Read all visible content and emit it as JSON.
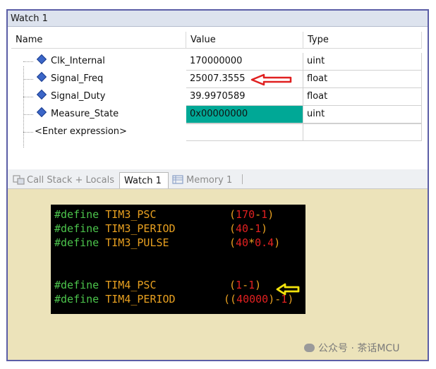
{
  "window": {
    "title": "Watch 1"
  },
  "columns": {
    "name": "Name",
    "value": "Value",
    "type": "Type"
  },
  "rows": [
    {
      "name": "Clk_Internal",
      "value": "170000000",
      "type": "uint"
    },
    {
      "name": "Signal_Freq",
      "value": "25007.3555",
      "type": "float"
    },
    {
      "name": "Signal_Duty",
      "value": "39.9970589",
      "type": "float"
    },
    {
      "name": "Measure_State",
      "value": "0x00000000",
      "type": "uint"
    }
  ],
  "enter_expression": "<Enter expression>",
  "tabs": [
    {
      "label": "Call Stack + Locals"
    },
    {
      "label": "Watch 1"
    },
    {
      "label": "Memory 1"
    }
  ],
  "code": [
    {
      "kw": "#define",
      "name": "TIM3_PSC",
      "expr": [
        [
          "(",
          "op"
        ],
        [
          "170",
          "num"
        ],
        [
          "-",
          "op"
        ],
        [
          "1",
          "num"
        ],
        [
          ")",
          "op"
        ]
      ]
    },
    {
      "kw": "#define",
      "name": "TIM3_PERIOD",
      "expr": [
        [
          "(",
          "op"
        ],
        [
          "40",
          "num"
        ],
        [
          "-",
          "op"
        ],
        [
          "1",
          "num"
        ],
        [
          ")",
          "op"
        ]
      ]
    },
    {
      "kw": "#define",
      "name": "TIM3_PULSE",
      "expr": [
        [
          "(",
          "op"
        ],
        [
          "40",
          "num"
        ],
        [
          "*",
          "op"
        ],
        [
          "0.4",
          "num"
        ],
        [
          ")",
          "op"
        ]
      ]
    },
    {
      "kw": "#define",
      "name": "TIM4_PSC",
      "expr": [
        [
          "(",
          "op"
        ],
        [
          "1",
          "num"
        ],
        [
          "-",
          "op"
        ],
        [
          "1",
          "num"
        ],
        [
          ")",
          "op"
        ]
      ]
    },
    {
      "kw": "#define",
      "name": "TIM4_PERIOD",
      "expr": [
        [
          "((",
          "op"
        ],
        [
          "40000",
          "num"
        ],
        [
          ")",
          "op"
        ],
        [
          "-",
          "op"
        ],
        [
          "1",
          "num"
        ],
        [
          ")",
          "op"
        ]
      ]
    }
  ],
  "watermark": "公众号 · 茶话MCU",
  "colors": {
    "highlight": "#00a896",
    "arrow_red": "#e02020",
    "arrow_yellow": "#f2e20c"
  }
}
